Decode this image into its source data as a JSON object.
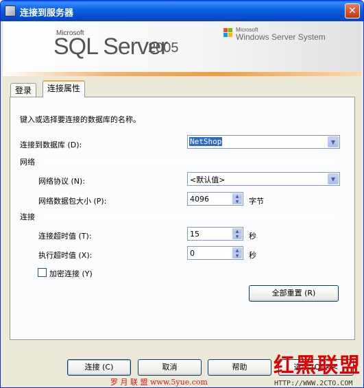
{
  "window": {
    "title": "连接到服务器",
    "close_glyph": "✕"
  },
  "banner": {
    "microsoft": "Microsoft",
    "product": "SQL Server",
    "version": "2005",
    "microsoft2": "Microsoft",
    "system": "Windows Server System"
  },
  "tabs": [
    {
      "label": "登录",
      "active": false
    },
    {
      "label": "连接属性",
      "active": true
    }
  ],
  "form": {
    "instruction": "键入或选择要连接的数据库的名称。",
    "database_label": "连接到数据库 (D):",
    "database_value": "NetShop",
    "network_section": "网络",
    "protocol_label": "网络协议 (N):",
    "protocol_value": "<默认值>",
    "packet_label": "网络数据包大小 (P):",
    "packet_value": "4096",
    "packet_unit": "字节",
    "connection_section": "连接",
    "timeout_label": "连接超时值 (T):",
    "timeout_value": "15",
    "timeout_unit": "秒",
    "exec_timeout_label": "执行超时值 (X):",
    "exec_timeout_value": "0",
    "exec_timeout_unit": "秒",
    "encrypt_label": "加密连接 (Y)",
    "encrypt_checked": false,
    "reset_button": "全部重置 (R)"
  },
  "footer": {
    "connect": "连接 (C)",
    "cancel": "取消",
    "help": "帮助",
    "options": "选项 (O) <<"
  },
  "watermarks": {
    "big": "红黑联盟",
    "url_left": "罗 月 联 盟  www.5yue.com",
    "url_right": "HTTP://WWW.2CTO.COM"
  },
  "colors": {
    "title_bar": "#0a5fe8",
    "selection": "#316ac5",
    "accent_orange": "#f39a3c",
    "watermark_red": "#e00000"
  }
}
